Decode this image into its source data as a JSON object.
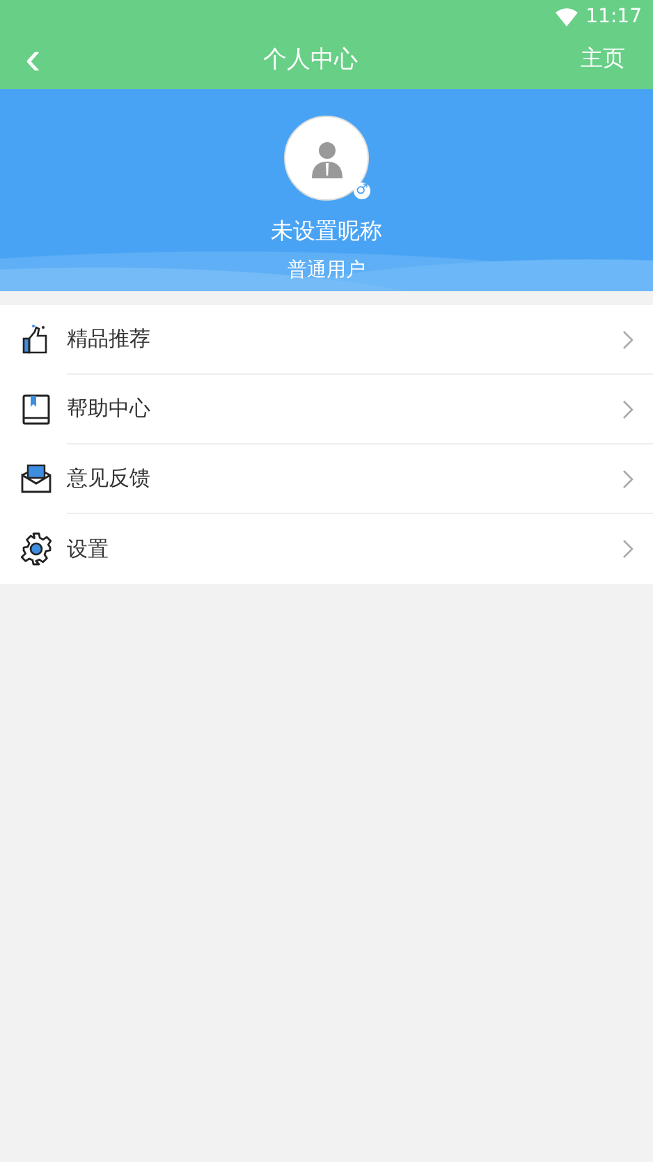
{
  "status_bar": {
    "time": "11:17"
  },
  "header": {
    "back": "‹",
    "title": "个人中心",
    "action": "主页"
  },
  "profile": {
    "nickname": "未设置昵称",
    "role": "普通用户",
    "gender_mark": "♂"
  },
  "menu": [
    {
      "kind": "thumb",
      "label": "精品推荐"
    },
    {
      "kind": "book",
      "label": "帮助中心"
    },
    {
      "kind": "mail",
      "label": "意见反馈"
    },
    {
      "kind": "gear",
      "label": "设置"
    }
  ]
}
